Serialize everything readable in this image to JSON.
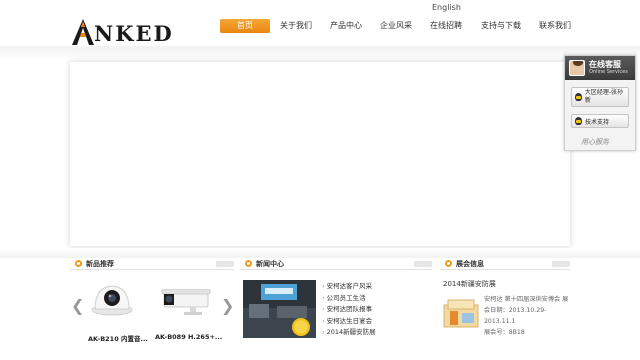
{
  "header": {
    "logo_text": "NKED",
    "logo_letter": "A",
    "logo_reg": "®",
    "lang_link": "English"
  },
  "nav": {
    "items": [
      {
        "label": "首页",
        "active": true
      },
      {
        "label": "关于我们",
        "active": false
      },
      {
        "label": "产品中心",
        "active": false
      },
      {
        "label": "企业风采",
        "active": false
      },
      {
        "label": "在线招聘",
        "active": false
      },
      {
        "label": "支持与下载",
        "active": false
      },
      {
        "label": "联系我们",
        "active": false
      }
    ]
  },
  "products": {
    "title": "新品推荐",
    "items": [
      {
        "label": "AK-B210 内置音..."
      },
      {
        "label": "AK-B089 H.265+..."
      }
    ],
    "prev_icon": "chevron-left-icon",
    "next_icon": "chevron-right-icon"
  },
  "news": {
    "title": "新闻中心",
    "items": [
      "安柯达客户风采",
      "公司员工生活",
      "安柯达团队报事",
      "安柯达生日宴会",
      "2014新疆安防展"
    ]
  },
  "sponsor": {
    "title": "展会信息",
    "headline": "2014新疆安防展",
    "info": [
      "安柯达 第十四届深圳安博会 展",
      "会日期：2013.10.29-",
      "2013.11.1",
      "展会号：8B18"
    ]
  },
  "online_service": {
    "title": "在线客服",
    "subtitle": "Online Services",
    "contacts": [
      "大区经理-张孙新",
      "技术支持"
    ],
    "footer": "用心服务"
  },
  "colors": {
    "accent": "#e9850f",
    "nav_active_top": "#f5a83a"
  }
}
